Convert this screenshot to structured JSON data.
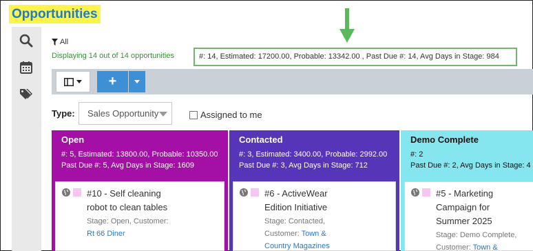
{
  "page_title": "Opportunities",
  "filter": {
    "label": "All",
    "icon": "filter-icon"
  },
  "displaying": "Displaying 14 out of 14 opportunities",
  "summary": "#: 14, Estimated: 17200.00, Probable: 13342.00 , Past Due #: 14, Avg Days in Stage: 984",
  "rail_icons": [
    "search-icon",
    "calendar-icon",
    "tags-icon"
  ],
  "toolbar": {
    "view_icon": "columns-icon",
    "add_label": "+",
    "add_dropdown_icon": "caret-down-icon"
  },
  "type_label": "Type:",
  "type_value": "Sales Opportunity",
  "assigned_label": "Assigned to me",
  "columns": [
    {
      "title": "Open",
      "stats_line1": "#: 5, Estimated: 13800.00, Probable: 10350.00",
      "stats_line2": "Past Due #: 5, Avg Days in Stage: 1609",
      "color": "#a40fa6",
      "card": {
        "title_line1": "#10 - Self cleaning",
        "title_line2": "robot to clean tables",
        "stage": "Stage: Open, Customer:",
        "customer": "Rt 66 Diner"
      }
    },
    {
      "title": "Contacted",
      "stats_line1": "#: 3, Estimated: 3400.00, Probable: 2992.00",
      "stats_line2": "Past Due #: 3, Avg Days in Stage: 712",
      "color": "#5635b8",
      "card": {
        "title_line1": "#6 - ActiveWear",
        "title_line2": "Edition Initiative",
        "stage": "Stage: Contacted,",
        "customer_prefix": "Customer: ",
        "customer": "Town &",
        "customer_line2": "Country Magazines"
      }
    },
    {
      "title": "Demo Complete",
      "stats_line1": "#: 2",
      "stats_line2": "Past Due #: 2, Avg Days in Stage: 4",
      "color": "#86e6f0",
      "card": {
        "title_line1": "#5 - Marketing",
        "title_line2": "Campaign for",
        "title_line3": "Summer 2025",
        "stage": "Stage: Demo Complete,",
        "customer_prefix": "Customer: ",
        "customer": "Town &"
      }
    }
  ]
}
